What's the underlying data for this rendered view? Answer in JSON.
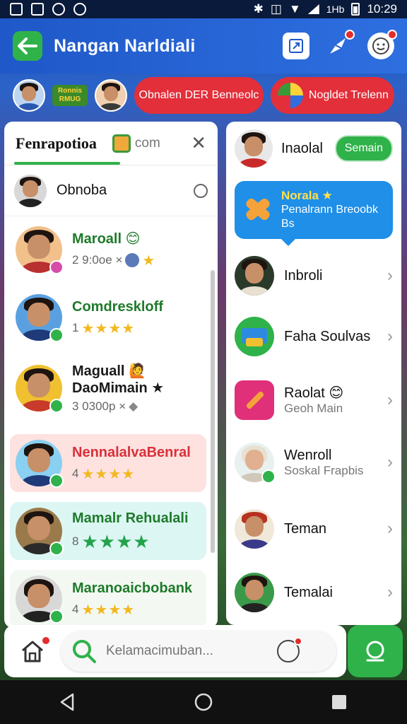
{
  "status_bar": {
    "time": "10:29",
    "net": "1Hb"
  },
  "header": {
    "title": "Nangan Narldiali"
  },
  "strip": {
    "badge_text": "Ronnis RMUG",
    "pill_left": "Obnalen DER Benneolc",
    "pill_right": "Nogldet Trelenn"
  },
  "left_panel": {
    "tab_active": "Fenrapotioa",
    "tab_second": "com",
    "search_row_label": "Obnoba",
    "contacts": [
      {
        "name": "Maroall 😊",
        "meta": "2 9:0oe ×",
        "stars": "★",
        "status": "pink"
      },
      {
        "name": "Comdreskloff",
        "meta": "1",
        "stars": "★★★★",
        "status": "green"
      },
      {
        "name": "Maguall 🙋",
        "name2": "DaoMimain ★",
        "meta": "3 0300p ×",
        "stars": "",
        "status": "green"
      },
      {
        "name": "NennalalvaBenral",
        "meta": "4",
        "stars": "★★★★",
        "status": "green"
      },
      {
        "name": "Mamalr Rehualali",
        "meta": "8",
        "stars": "★★★★",
        "status": "green"
      },
      {
        "name": "Maranoaicbobank",
        "meta": "4",
        "stars": "★★★★",
        "status": "green"
      }
    ]
  },
  "right_panel": {
    "top_name": "Inaolal",
    "top_button": "Semain",
    "bubble_title": "Norala ★",
    "bubble_text": "Penalrann Breoobk Bs",
    "items": [
      {
        "label": "Inbroli",
        "sub": ""
      },
      {
        "label": "Faha Soulvas",
        "sub": ""
      },
      {
        "label": "Raolat 😊",
        "sub": "Geoh Main"
      },
      {
        "label": "Wenroll",
        "sub": "Soskal Frapbis"
      },
      {
        "label": "Teman",
        "sub": ""
      },
      {
        "label": "Temalai",
        "sub": ""
      }
    ]
  },
  "bottom": {
    "search_placeholder": "Kelamacimuban..."
  },
  "colors": {
    "accent": "#2fb24a",
    "header": "#1f58c8",
    "pill": "#e22f3a",
    "bubble": "#1f8fe8"
  }
}
